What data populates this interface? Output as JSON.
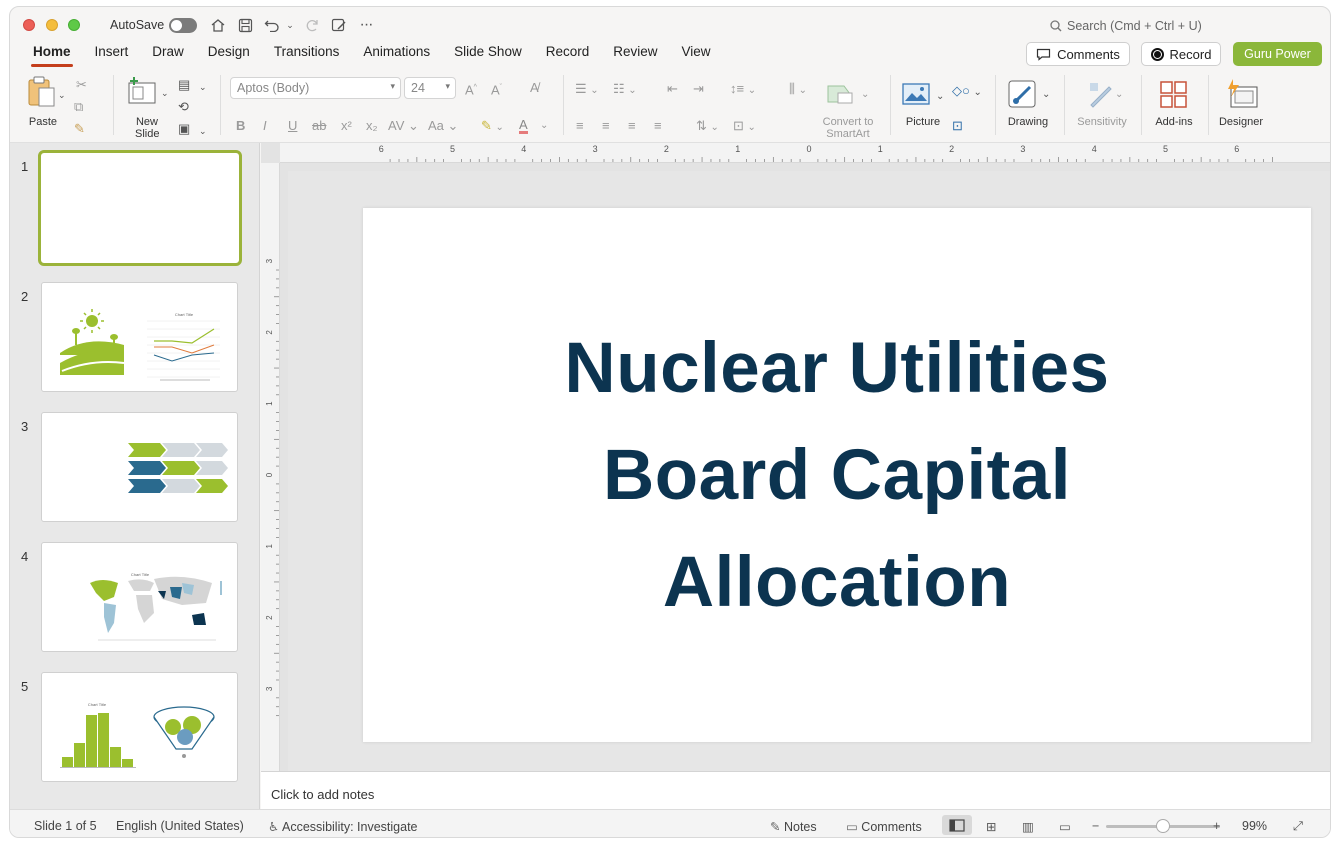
{
  "titlebar": {
    "autosave_label": "AutoSave",
    "search_placeholder": "Search (Cmd + Ctrl + U)"
  },
  "tabs": [
    "Home",
    "Insert",
    "Draw",
    "Design",
    "Transitions",
    "Animations",
    "Slide Show",
    "Record",
    "Review",
    "View"
  ],
  "actions": {
    "comments": "Comments",
    "record": "Record",
    "guru": "Guru Power",
    "guru_color": "#8bb73a"
  },
  "ribbon": {
    "paste": "Paste",
    "new_slide_line1": "New",
    "new_slide_line2": "Slide",
    "font_name": "Aptos (Body)",
    "font_size": "24",
    "convert_line1": "Convert to",
    "convert_line2": "SmartArt",
    "picture": "Picture",
    "drawing": "Drawing",
    "sensitivity": "Sensitivity",
    "addins": "Add-ins",
    "designer": "Designer"
  },
  "thumbnails": [
    {
      "num": "1"
    },
    {
      "num": "2",
      "chart_title": "Chart Title"
    },
    {
      "num": "3"
    },
    {
      "num": "4",
      "chart_title": "Chart Title"
    },
    {
      "num": "5",
      "chart_title": "Chart Title"
    }
  ],
  "ruler": {
    "top_ticks": [
      "6",
      "5",
      "4",
      "3",
      "2",
      "1",
      "0",
      "1",
      "2",
      "3",
      "4",
      "5",
      "6"
    ],
    "left_ticks": [
      "3",
      "2",
      "1",
      "0",
      "1",
      "2",
      "3"
    ]
  },
  "slide": {
    "title": "Nuclear Utilities Board Capital Allocation",
    "title_color": "#0c3450"
  },
  "notes_placeholder": "Click to add notes",
  "status": {
    "slide_indicator": "Slide 1 of 5",
    "language": "English (United States)",
    "accessibility": "Accessibility: Investigate",
    "notes": "Notes",
    "comments": "Comments",
    "zoom": "99%",
    "zoom_level": 0.5
  }
}
